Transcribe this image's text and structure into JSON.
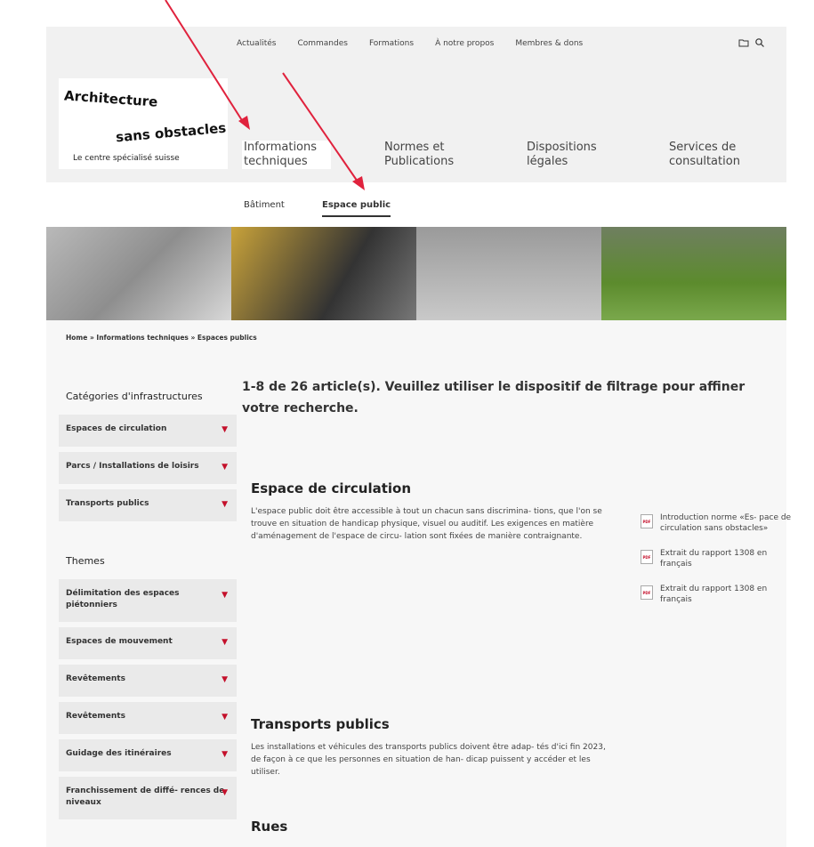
{
  "topnav": [
    "Actualités",
    "Commandes",
    "Formations",
    "À notre propos",
    "Membres & dons"
  ],
  "logo": {
    "line1": "Architecture",
    "line2": "sans obstacles",
    "tagline": "Le centre spécialisé suisse"
  },
  "mainnav": [
    {
      "label": "Informations techniques",
      "active": true
    },
    {
      "label": "Normes et Publications",
      "active": false
    },
    {
      "label": "Dispositions légales",
      "active": false
    },
    {
      "label": "Services de consultation",
      "active": false
    }
  ],
  "subnav": [
    {
      "label": "Bâtiment",
      "active": false
    },
    {
      "label": "Espace public",
      "active": true
    }
  ],
  "breadcrumb": "Home » Informations techniques » Espaces publics",
  "sidebar": {
    "categories_title": "Catégories d'infrastructures",
    "categories": [
      "Espaces de circulation",
      "Parcs / Installations de loisirs",
      "Transports publics"
    ],
    "themes_title": "Themes",
    "themes": [
      "Délimitation des espaces piétonniers",
      "Espaces de mouvement",
      "Revêtements",
      "Revêtements",
      "Guidage des itinéraires",
      "Franchissement de diffé- rences de niveaux"
    ]
  },
  "summary": "1-8 de 26 article(s). Veuillez utiliser le dispositif de filtrage pour affiner votre recherche.",
  "sections": [
    {
      "title": "Espace de circulation",
      "body": "L'espace public doit être accessible à tout un chacun sans discrimina- tions, que l'on se trouve en situation de handicap physique, visuel ou auditif. Les exigences en matière d'aménagement de l'espace de circu- lation sont fixées de manière contraignante."
    },
    {
      "title": "Transports publics",
      "body": "Les installations et véhicules des transports publics doivent être adap- tés d'ici fin 2023, de façon à ce que les personnes en situation de han- dicap puissent y accéder et les utiliser."
    },
    {
      "title": "Rues",
      "body": ""
    }
  ],
  "documents": [
    "Introduction norme «Es- pace de circulation sans obstacles»",
    "Extrait du rapport 1308 en français",
    "Extrait du rapport 1308 en français"
  ],
  "pdf_label": "PDF",
  "colors": {
    "accent": "#c4102b",
    "arrow": "#e0223d"
  }
}
